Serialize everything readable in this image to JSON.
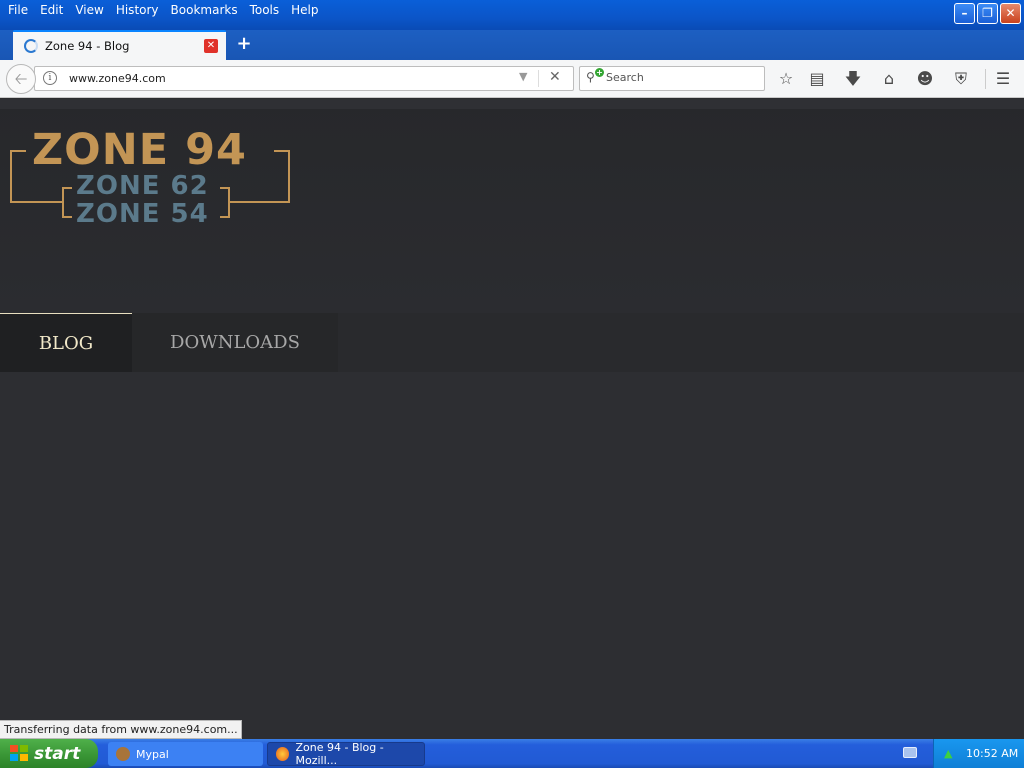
{
  "menubar": {
    "items": [
      "File",
      "Edit",
      "View",
      "History",
      "Bookmarks",
      "Tools",
      "Help"
    ]
  },
  "window_buttons": {
    "minimize": "minimize-icon",
    "restore": "restore-icon",
    "close": "close-icon"
  },
  "tab": {
    "title": "Zone 94 - Blog",
    "new_tab_symbol": "+"
  },
  "navbar": {
    "url": "www.zone94.com",
    "search_placeholder": "Search",
    "buttons": [
      "bookmark-star-icon",
      "reader-icon",
      "download-icon",
      "home-icon",
      "smiley-icon",
      "pocket-icon",
      "menu-icon"
    ]
  },
  "site": {
    "logo_main": "ZONE 94",
    "logo_sub1": "ZONE 62",
    "logo_sub2": "ZONE 54",
    "nav": [
      "BLOG",
      "DOWNLOADS"
    ]
  },
  "status_text": "Transferring data from www.zone94.com...",
  "taskbar": {
    "start_label": "start",
    "items": [
      "Mypal",
      "Zone 94 - Blog - Mozill..."
    ],
    "clock": "10:52 AM"
  },
  "colors": {
    "logo_gold": "#c39555",
    "logo_steel": "#5b7a8b",
    "page_bg": "#2d2e32",
    "taskbar_blue": "#245edb"
  }
}
